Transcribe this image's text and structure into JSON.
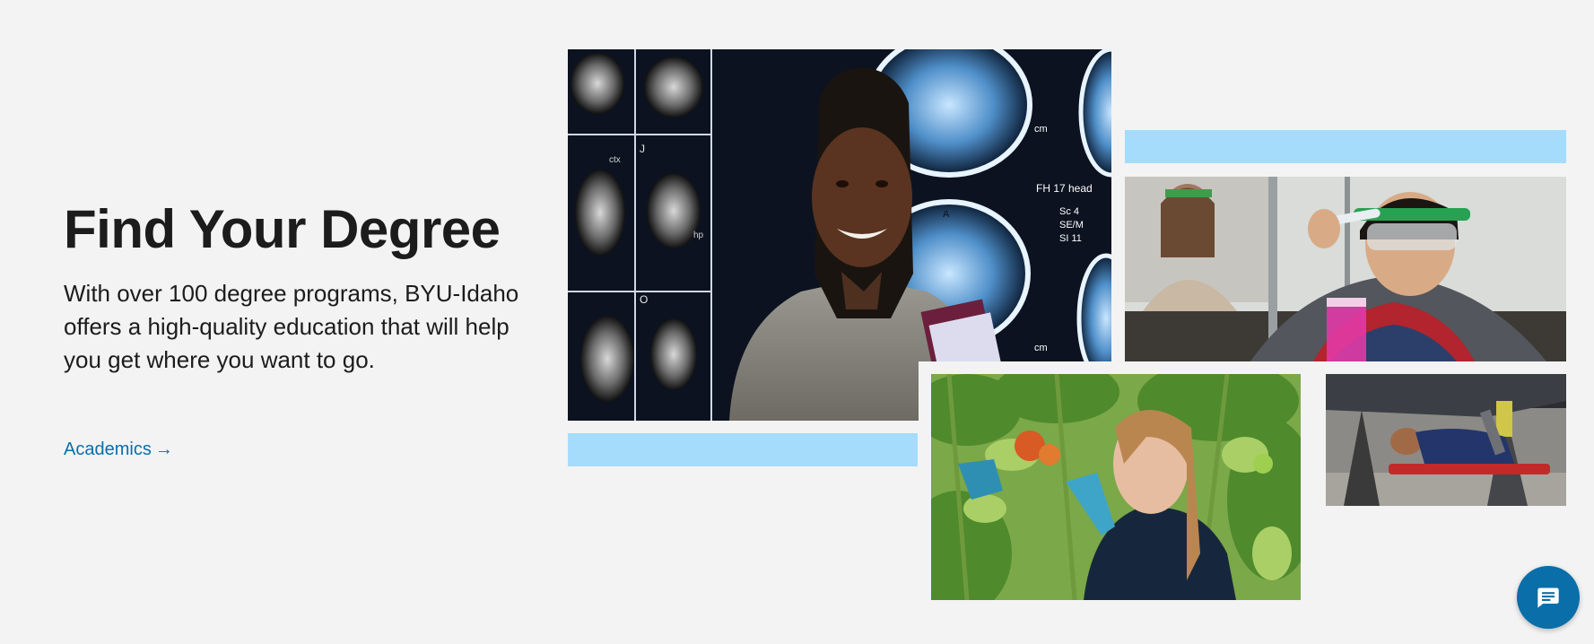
{
  "hero": {
    "title": "Find Your Degree",
    "description": "With over 100 degree programs, BYU-Idaho offers a high-quality education that will help you get where you want to go.",
    "link_label": "Academics",
    "link_arrow": "→"
  },
  "images": {
    "brain_scan_labels": [
      "FH 17 head",
      "Sc 4",
      "SE/M",
      "SI 11",
      "cm",
      "cm",
      "ctx",
      "J",
      "O",
      "A",
      "hp"
    ]
  },
  "colors": {
    "background": "#f3f3f3",
    "accent_band": "#a6dcfb",
    "link": "#0a6ea8",
    "chat_button": "#0a6ea8"
  },
  "icons": {
    "link_arrow": "arrow-right-icon",
    "chat": "chat-bubble-icon"
  }
}
